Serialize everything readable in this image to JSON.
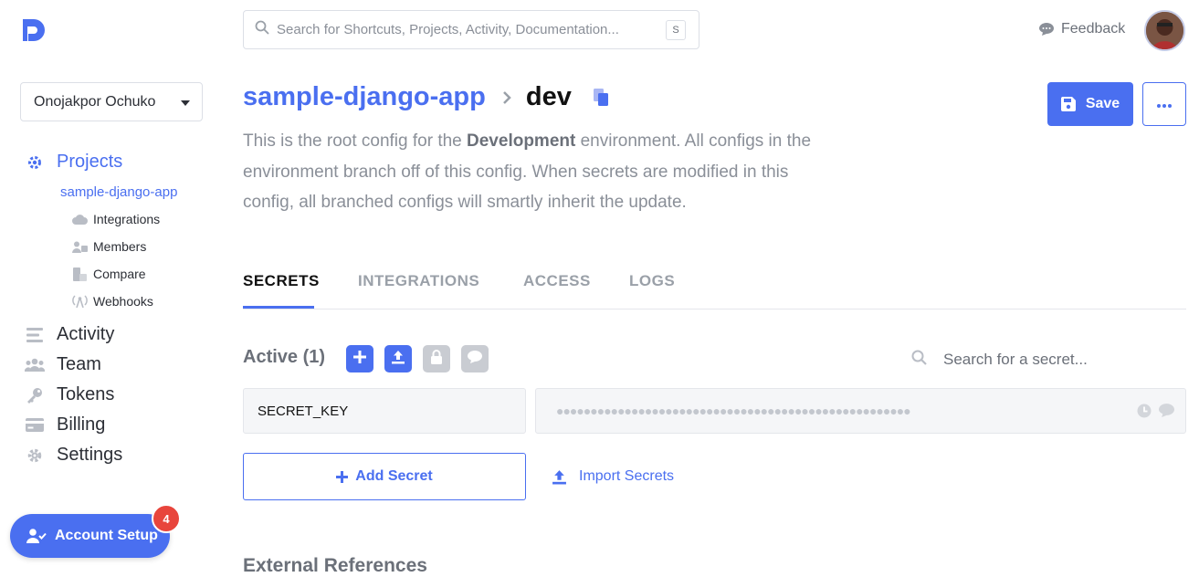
{
  "colors": {
    "accent": "#4a6ff0",
    "badge": "#e8453c",
    "muted": "#8a8f98"
  },
  "org": {
    "name": "Onojakpor Ochuko"
  },
  "search": {
    "placeholder": "Search for Shortcuts, Projects, Activity, Documentation...",
    "shortcut": "S"
  },
  "header": {
    "feedback_label": "Feedback"
  },
  "sidebar": {
    "projects_label": "Projects",
    "project_name": "sample-django-app",
    "project_items": [
      {
        "label": "Integrations",
        "icon": "cloud-icon"
      },
      {
        "label": "Members",
        "icon": "members-icon"
      },
      {
        "label": "Compare",
        "icon": "compare-icon"
      },
      {
        "label": "Webhooks",
        "icon": "webhooks-icon"
      }
    ],
    "items": [
      {
        "label": "Activity",
        "icon": "activity-icon"
      },
      {
        "label": "Team",
        "icon": "team-icon"
      },
      {
        "label": "Tokens",
        "icon": "key-icon"
      },
      {
        "label": "Billing",
        "icon": "credit-card-icon"
      },
      {
        "label": "Settings",
        "icon": "gear-icon"
      }
    ],
    "account_setup_label": "Account Setup",
    "account_setup_badge": "4"
  },
  "page": {
    "project": "sample-django-app",
    "environment": "dev",
    "desc_pre": "This is the root config for the ",
    "desc_bold": "Development",
    "desc_post": " environment. All configs in the environment branch off of this config. When secrets are modified in this config, all branched configs will smartly inherit the update.",
    "save_label": "Save"
  },
  "tabs": [
    {
      "label": "SECRETS",
      "active": true
    },
    {
      "label": "INTEGRATIONS",
      "active": false
    },
    {
      "label": "ACCESS",
      "active": false
    },
    {
      "label": "LOGS",
      "active": false
    }
  ],
  "secrets": {
    "title": "Active (1)",
    "search_placeholder": "Search for a secret...",
    "rows": [
      {
        "key": "SECRET_KEY",
        "value_masked": "●●●●●●●●●●●●●●●●●●●●●●●●●●●●●●●●●●●●●●●●●●●●●●●●●●●●"
      }
    ],
    "add_label": "Add Secret",
    "import_label": "Import Secrets"
  },
  "external_references": {
    "title": "External References"
  }
}
